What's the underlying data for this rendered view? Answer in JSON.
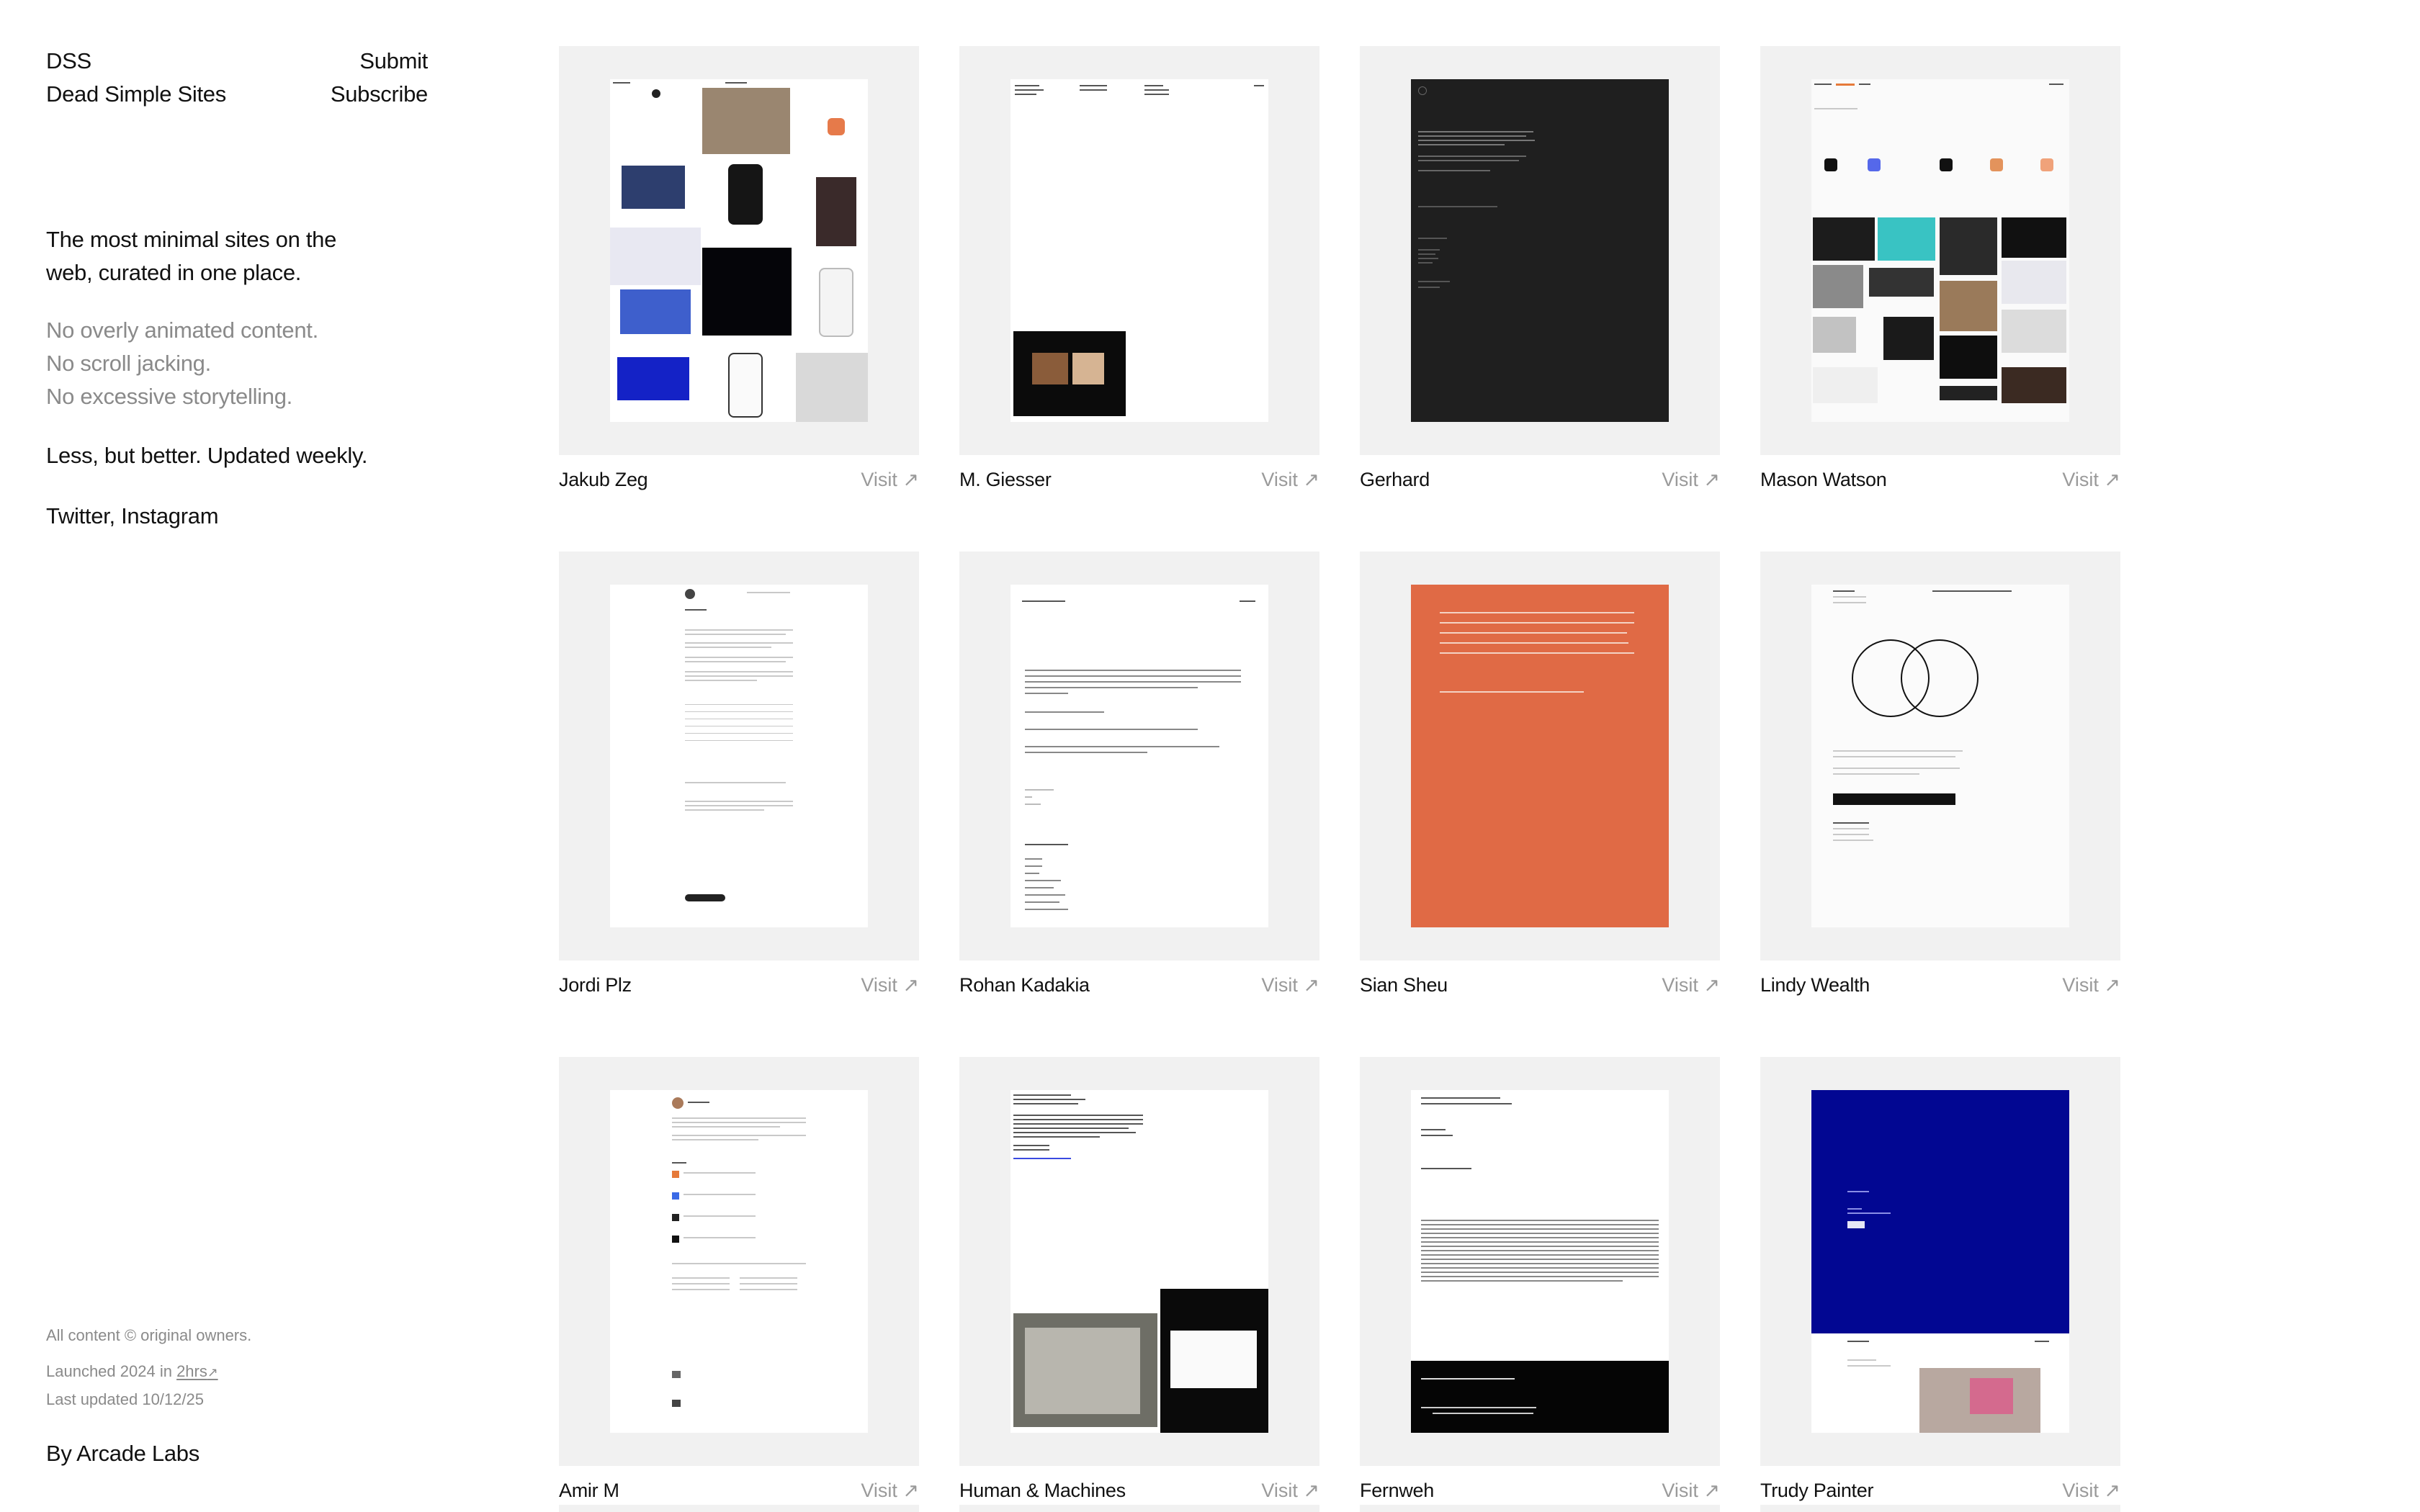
{
  "sidebar": {
    "abbr": "DSS",
    "site_name": "Dead Simple Sites",
    "submit": "Submit",
    "subscribe": "Subscribe",
    "tagline_1": "The most minimal sites on the",
    "tagline_2": "web, curated in one place.",
    "no_1": "No overly animated content.",
    "no_2": "No scroll jacking.",
    "no_3": "No excessive storytelling.",
    "better": "Less, but better. Updated weekly.",
    "social": "Twitter, Instagram",
    "copyright": "All content © original owners.",
    "launched_prefix": "Launched 2024 in",
    "launched_link": "2hrs",
    "updated": "Last updated 10/12/25",
    "by": "By Arcade Labs"
  },
  "visit_label": "Visit",
  "arrow": "↗",
  "sites": [
    {
      "name": "Jakub Zeg"
    },
    {
      "name": "M. Giesser"
    },
    {
      "name": "Gerhard"
    },
    {
      "name": "Mason Watson"
    },
    {
      "name": "Jordi Plz"
    },
    {
      "name": "Rohan Kadakia"
    },
    {
      "name": "Sian Sheu"
    },
    {
      "name": "Lindy Wealth"
    },
    {
      "name": "Amir M"
    },
    {
      "name": "Human & Machines"
    },
    {
      "name": "Fernweh"
    },
    {
      "name": "Trudy Painter"
    }
  ],
  "colors": {
    "thumb_bg": "#f1f1f1",
    "muted_text": "#8a8a8a",
    "sian_orange": "#e06a45",
    "trudy_blue": "#020792",
    "gerhard_dark": "#1f1f1f"
  }
}
